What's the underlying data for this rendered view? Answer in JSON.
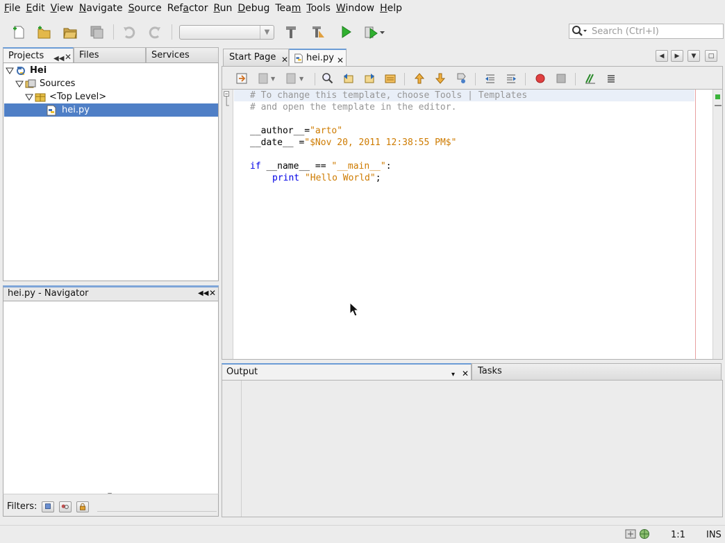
{
  "menu": [
    {
      "pre": "",
      "mn": "F",
      "post": "ile"
    },
    {
      "pre": "",
      "mn": "E",
      "post": "dit"
    },
    {
      "pre": "",
      "mn": "V",
      "post": "iew"
    },
    {
      "pre": "",
      "mn": "N",
      "post": "avigate"
    },
    {
      "pre": "",
      "mn": "S",
      "post": "ource"
    },
    {
      "pre": "Ref",
      "mn": "a",
      "post": "ctor"
    },
    {
      "pre": "",
      "mn": "R",
      "post": "un"
    },
    {
      "pre": "",
      "mn": "D",
      "post": "ebug"
    },
    {
      "pre": "Tea",
      "mn": "m",
      "post": ""
    },
    {
      "pre": "",
      "mn": "T",
      "post": "ools"
    },
    {
      "pre": "",
      "mn": "W",
      "post": "indow"
    },
    {
      "pre": "",
      "mn": "H",
      "post": "elp"
    }
  ],
  "search": {
    "placeholder": "Search (Ctrl+I)"
  },
  "left_tabs": {
    "projects": "Projects",
    "files": "Files",
    "services": "Services"
  },
  "tree": {
    "project": "Hei",
    "sources": "Sources",
    "top_level": "<Top Level>",
    "file": "hei.py"
  },
  "navigator": {
    "title": "hei.py - Navigator"
  },
  "filters": {
    "label": "Filters:"
  },
  "editor_tabs": {
    "start_page": "Start Page",
    "file": "hei.py"
  },
  "code": {
    "line1": "# To change this template, choose Tools | Templates",
    "line2": "# and open the template in the editor.",
    "author_key": "__author__=",
    "author_val": "\"arto\"",
    "date_key": "__date__ =",
    "date_val": "\"$Nov 20, 2011 12:38:55 PM$\"",
    "if_kw": "if",
    "if_mid": " __name__ == ",
    "if_str": "\"__main__\"",
    "if_end": ":",
    "print_kw": "print",
    "print_str": "\"Hello World\"",
    "print_end": ";"
  },
  "output_tabs": {
    "output": "Output",
    "tasks": "Tasks"
  },
  "status": {
    "position": "1:1",
    "mode": "INS"
  },
  "colors": {
    "accent": "#6b9cd6",
    "selection": "#4f7fc6",
    "comment": "#969696",
    "string": "#ce7b00",
    "keyword": "#0000e6"
  }
}
